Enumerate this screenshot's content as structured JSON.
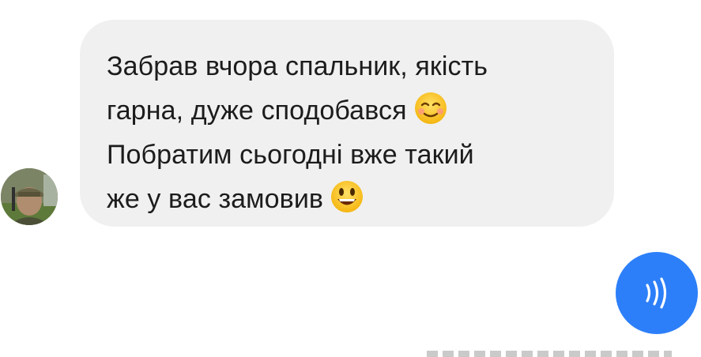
{
  "conversation": {
    "incoming_message": {
      "lines": [
        "Забрав вчора спальник, якість",
        "гарна, дуже сподобався",
        "Побратим сьогодні вже такий",
        "же у вас замовив"
      ],
      "emoji_line_2": "relieved-face-emoji",
      "emoji_line_4": "grinning-face-emoji"
    },
    "sender_avatar": {
      "icon": "user-avatar-photo"
    },
    "sound_button": {
      "icon": "sound-waves-icon",
      "color": "#2d7ff9"
    }
  },
  "colors": {
    "bubble_background": "#f0f0f0",
    "text": "#1c1c1c",
    "accent": "#2d7ff9"
  }
}
